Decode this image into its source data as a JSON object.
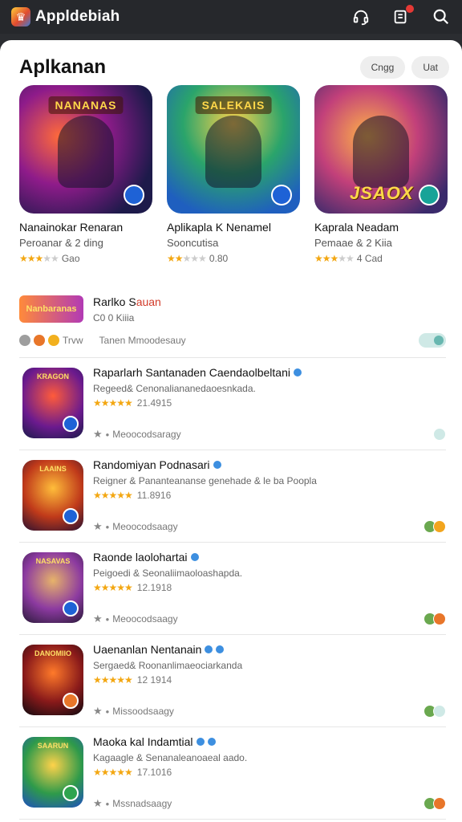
{
  "topbar": {
    "app_name": "Appldebiah",
    "icons": [
      "app-logo-icon",
      "headset-icon",
      "notification-icon",
      "search-icon"
    ]
  },
  "section": {
    "title": "Aplkanan",
    "chips": [
      "Cngg",
      "Uat"
    ]
  },
  "featured": [
    {
      "banner": "NANANAS",
      "title": "Nanainokar Renaran",
      "subtitle": "Peroanar & 2 ding",
      "rating_text": "Gao",
      "stars": 3.5,
      "badge_color": "#1e62d6"
    },
    {
      "banner": "SALEKAIS",
      "title": "Aplikapla K Nenamel",
      "subtitle": "Sooncutisa",
      "rating_text": "0.80",
      "stars": 2.5,
      "badge_color": "#1e62d6"
    },
    {
      "banner": "",
      "word": "JSAOX",
      "title": "Kaprala Neadam",
      "subtitle": "Pemaae & 2 Kiia",
      "rating_text": "4 Cad",
      "stars": 3.5,
      "badge_color": "#17a398"
    }
  ],
  "banner_item": {
    "thumb_label": "Nanbaranas",
    "title_main": "Rarlko S",
    "title_accent": "auan",
    "meta": "C0 0 Kiiia",
    "foot_text": "Tanen Mmoodesauy",
    "mini_label": "Trvw"
  },
  "apps": [
    {
      "icon_banner": "KRAGON",
      "title": "Raparlarh Santanaden Caendaolbeltani",
      "desc": "Regeed& Cenonaliananedaoesnkada.",
      "rating": "21.4915",
      "foot": "Meoocodsaragy"
    },
    {
      "icon_banner": "LAAINS",
      "title": "Randomiyan Podnasari",
      "desc": "Reigner & Pananteananse genehade & le ba Poopla",
      "rating": "11.8916",
      "foot": "Meoocodsaagy"
    },
    {
      "icon_banner": "NASAVAS",
      "title": "Raonde laolohartai",
      "desc": "Peigoedi & Seonaliimaoloashapda.",
      "rating": "12.1918",
      "foot": "Meoocodsaagy"
    },
    {
      "icon_banner": "DANOMIIO",
      "title": "Uaenanlan Nentanain",
      "desc": "Sergaed& Roonanlimaeociarkanda",
      "rating": "12 1914",
      "foot": "Missoodsaagy"
    },
    {
      "icon_banner": "SAARUN",
      "title": "Maoka kal Indamtial",
      "desc": "Kagaagle & Senanaleanoaeal aado.",
      "rating": "17.1016",
      "foot": "Mssnadsaagy"
    }
  ]
}
